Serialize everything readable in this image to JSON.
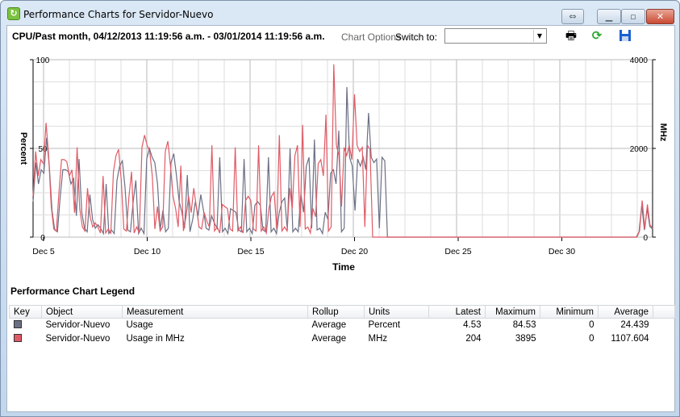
{
  "window": {
    "title": "Performance Charts for Servidor-Nuevo",
    "buttons": [
      "restore-toggle",
      "minimize",
      "maximize",
      "close"
    ]
  },
  "toolbar": {
    "heading": "CPU/Past month, 04/12/2013 11:19:56 a.m. - 03/01/2014 11:19:56 a.m.",
    "chart_options": "Chart Options",
    "switch_to": "Switch to:",
    "switch_value": "",
    "icons": [
      "print-icon",
      "refresh-icon",
      "save-icon"
    ]
  },
  "colors": {
    "usage": "#6b6f84",
    "usage_mhz": "#e05b66"
  },
  "chart_data": {
    "type": "line",
    "xlabel": "Time",
    "ylabel_left": "Percent",
    "ylabel_right": "MHz",
    "x_ticks": [
      "Dec 5",
      "Dec 10",
      "Dec 15",
      "Dec 20",
      "Dec 25",
      "Dec 30"
    ],
    "y_left_ticks": [
      "100",
      "50",
      "0"
    ],
    "y_right_ticks": [
      "4000",
      "2000",
      "0"
    ],
    "ylim_left": [
      0,
      100
    ],
    "ylim_right": [
      0,
      4000
    ],
    "x_range": [
      "2013-12-04 12:00",
      "2014-01-03 12:00"
    ],
    "sample_interval_hours": 3,
    "grid": true,
    "series": [
      {
        "name": "Usage",
        "axis": "left",
        "values": [
          20,
          42,
          30,
          38,
          36,
          56,
          40,
          15,
          4,
          3,
          22,
          38,
          38,
          37,
          30,
          33,
          12,
          44,
          14,
          5,
          3,
          24,
          10,
          5,
          7,
          5,
          2,
          30,
          2,
          4,
          2,
          32,
          40,
          43,
          28,
          4,
          3,
          20,
          32,
          2,
          5,
          2,
          44,
          50,
          45,
          42,
          30,
          4,
          15,
          3,
          5,
          42,
          47,
          35,
          20,
          14,
          5,
          35,
          3,
          10,
          20,
          12,
          24,
          15,
          5,
          4,
          12,
          8,
          5,
          45,
          3,
          5,
          2,
          16,
          15,
          14,
          4,
          3,
          44,
          3,
          5,
          2,
          18,
          20,
          18,
          4,
          3,
          45,
          3,
          5,
          2,
          14,
          20,
          22,
          4,
          50,
          3,
          5,
          3,
          24,
          14,
          40,
          45,
          5,
          55,
          4,
          5,
          2,
          14,
          10,
          36,
          38,
          30,
          60,
          3,
          5,
          84.53,
          45,
          40,
          15,
          44,
          40,
          45,
          38,
          70,
          45,
          42,
          44,
          5,
          45,
          43,
          0,
          0,
          0,
          0,
          0,
          0,
          0,
          0,
          0,
          0,
          0,
          0,
          0,
          0,
          0,
          0,
          0,
          0,
          0,
          0,
          0,
          0,
          0,
          0,
          0,
          0,
          0,
          0,
          0,
          0,
          0,
          0,
          0,
          0,
          0,
          0,
          0,
          0,
          0,
          0,
          0,
          0,
          0,
          0,
          0,
          0,
          0,
          0,
          0,
          0,
          0,
          0,
          0,
          0,
          0,
          0,
          0,
          0,
          0,
          0,
          0,
          0,
          0,
          0,
          0,
          0,
          0,
          0,
          0,
          0,
          0,
          0,
          0,
          0,
          0,
          0,
          0,
          0,
          0,
          0,
          0,
          0,
          0,
          0,
          0,
          0,
          0,
          0,
          0,
          0,
          0,
          0,
          0,
          3,
          18,
          4,
          16,
          6,
          4.53
        ]
      },
      {
        "name": "Usage in MHz",
        "axis": "right",
        "values": [
          920,
          1932,
          1380,
          1748,
          1656,
          2576,
          1840,
          690,
          184,
          138,
          1012,
          1748,
          1748,
          1702,
          1380,
          1518,
          552,
          2024,
          644,
          230,
          138,
          1104,
          460,
          230,
          322,
          230,
          92,
          1380,
          92,
          184,
          92,
          1472,
          1840,
          1978,
          1288,
          184,
          138,
          920,
          1472,
          92,
          230,
          92,
          2024,
          2300,
          2070,
          1932,
          1380,
          184,
          690,
          138,
          230,
          1932,
          2162,
          1610,
          920,
          644,
          230,
          1610,
          138,
          460,
          920,
          552,
          1104,
          690,
          230,
          184,
          552,
          368,
          230,
          2070,
          138,
          230,
          92,
          736,
          690,
          644,
          184,
          138,
          2024,
          138,
          230,
          92,
          828,
          920,
          828,
          184,
          138,
          2070,
          138,
          230,
          92,
          644,
          920,
          1012,
          184,
          2300,
          138,
          230,
          138,
          1104,
          644,
          1840,
          2070,
          230,
          2530,
          184,
          230,
          92,
          644,
          460,
          1656,
          1748,
          1380,
          2760,
          138,
          230,
          3895,
          2070,
          1840,
          690,
          2024,
          1840,
          2070,
          1748,
          3220,
          2070,
          1932,
          2024,
          230,
          2070,
          1978,
          0,
          0,
          0,
          0,
          0,
          0,
          0,
          0,
          0,
          0,
          0,
          0,
          0,
          0,
          0,
          0,
          0,
          0,
          0,
          0,
          0,
          0,
          0,
          0,
          0,
          0,
          0,
          0,
          0,
          0,
          0,
          0,
          0,
          0,
          0,
          0,
          0,
          0,
          0,
          0,
          0,
          0,
          0,
          0,
          0,
          0,
          0,
          0,
          0,
          0,
          0,
          0,
          0,
          0,
          0,
          0,
          0,
          0,
          0,
          0,
          0,
          0,
          0,
          0,
          0,
          0,
          0,
          0,
          0,
          0,
          0,
          0,
          0,
          0,
          0,
          0,
          0,
          0,
          0,
          0,
          0,
          0,
          0,
          0,
          0,
          0,
          0,
          0,
          0,
          0,
          0,
          0,
          0,
          0,
          0,
          0,
          0,
          0,
          0,
          0,
          0,
          0,
          0,
          138,
          828,
          184,
          736,
          276,
          204
        ]
      }
    ]
  },
  "legend": {
    "title": "Performance Chart Legend",
    "columns": [
      "Key",
      "Object",
      "Measurement",
      "Rollup",
      "Units",
      "Latest",
      "Maximum",
      "Minimum",
      "Average"
    ],
    "rows": [
      {
        "object": "Servidor-Nuevo",
        "measurement": "Usage",
        "rollup": "Average",
        "units": "Percent",
        "latest": "4.53",
        "maximum": "84.53",
        "minimum": "0",
        "average": "24.439"
      },
      {
        "object": "Servidor-Nuevo",
        "measurement": "Usage in MHz",
        "rollup": "Average",
        "units": "MHz",
        "latest": "204",
        "maximum": "3895",
        "minimum": "0",
        "average": "1107.604"
      }
    ]
  }
}
